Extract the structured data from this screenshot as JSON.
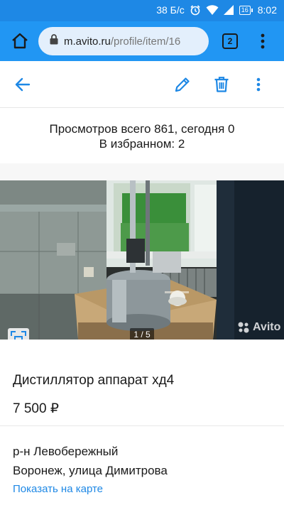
{
  "status_bar": {
    "speed": "38 Б/с",
    "battery": "16",
    "time": "8:02"
  },
  "browser": {
    "url_host": "m.avito.ru",
    "url_path": "/profile/item/16",
    "tab_count": "2"
  },
  "stats": {
    "views": "Просмотров всего 861, сегодня 0",
    "favorites": "В избранном: 2"
  },
  "photo": {
    "counter": "1 / 5",
    "watermark": "Avito"
  },
  "item": {
    "title": "Дистиллятор аппарат хд4",
    "price": "7 500 ₽",
    "district": "р-н Левобережный",
    "address": "Воронеж, улица Димитрова",
    "map_link": "Показать на карте"
  },
  "colors": {
    "status_bar": "#1e88e5",
    "browser_bar": "#2196f3",
    "accent": "#1e88e5"
  },
  "icons": [
    "alarm-icon",
    "wifi-icon",
    "signal-icon",
    "battery-icon",
    "home-icon",
    "lock-icon",
    "tab-switcher-icon",
    "overflow-menu-icon",
    "back-arrow-icon",
    "edit-pencil-icon",
    "trash-icon",
    "more-vert-icon",
    "fullscreen-icon",
    "avito-logo-icon"
  ]
}
